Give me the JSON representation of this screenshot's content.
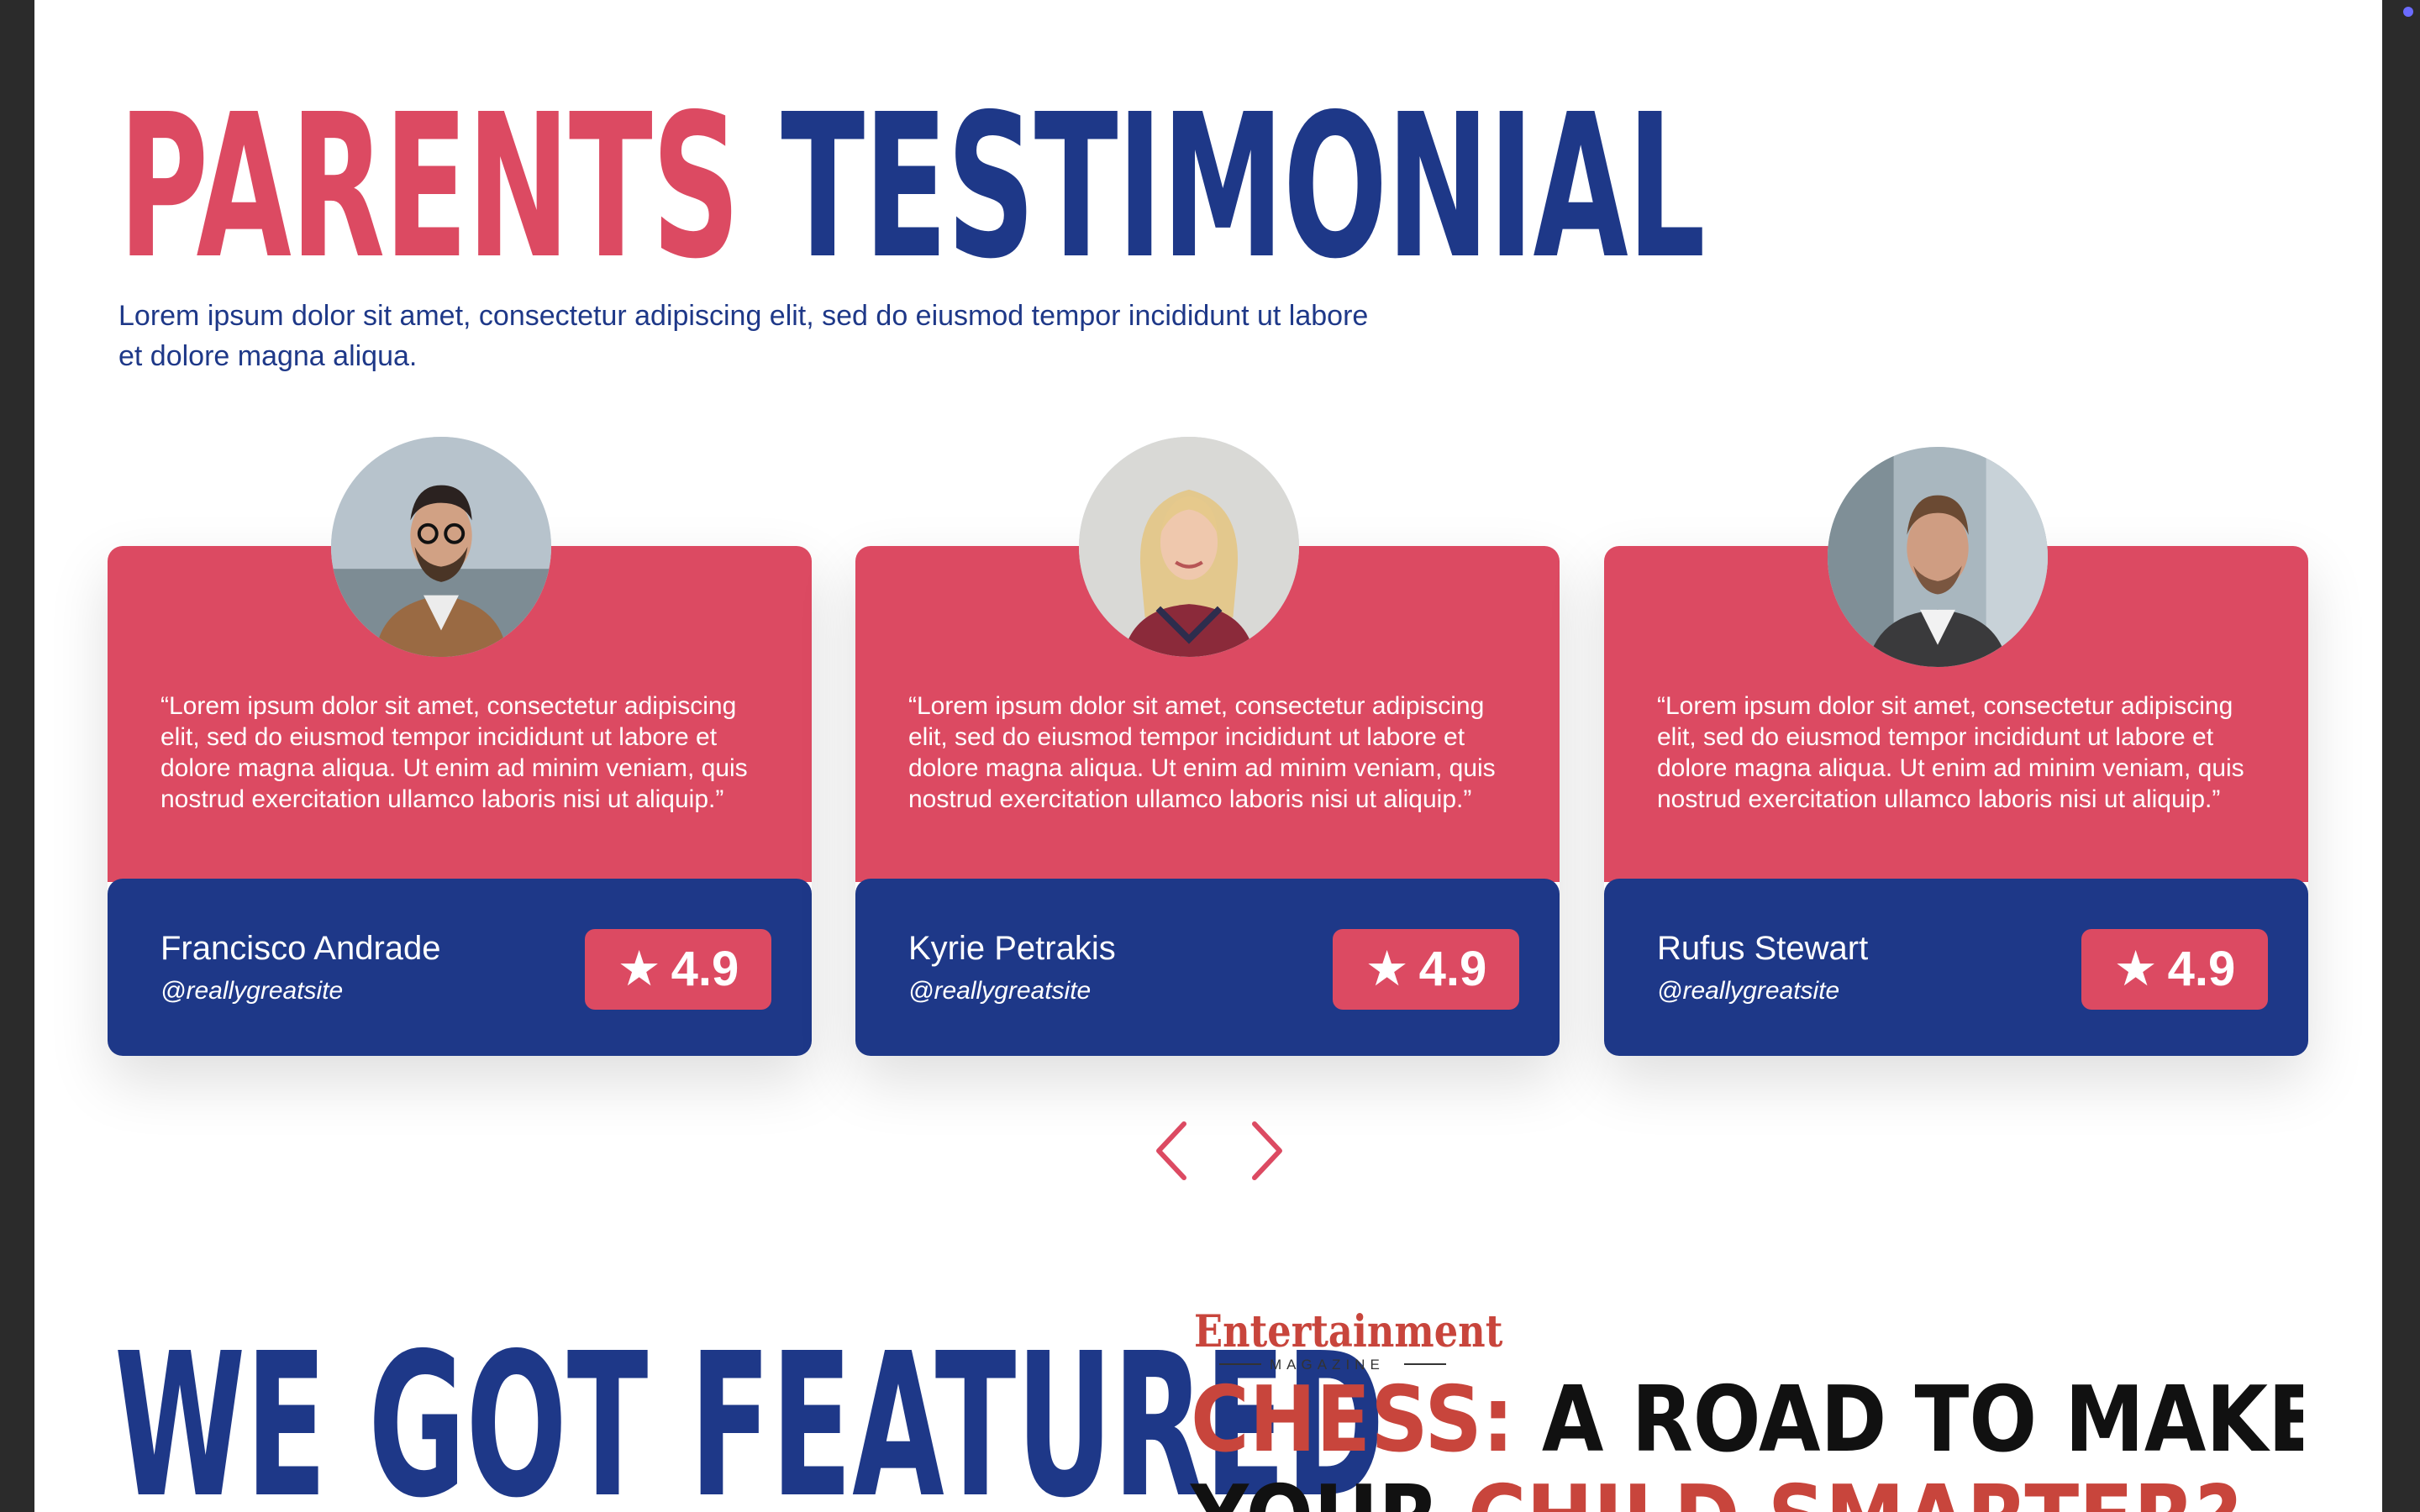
{
  "testimonials": {
    "title_part1": "PARENTS",
    "title_part2": "TESTIMONIAL",
    "intro": "Lorem ipsum dolor sit amet, consectetur adipiscing elit, sed do eiusmod tempor incididunt ut labore et dolore magna aliqua.",
    "cards": [
      {
        "quote": "“Lorem ipsum dolor sit amet, consectetur adipiscing elit, sed do eiusmod tempor incididunt ut labore et dolore magna aliqua. Ut enim ad minim veniam, quis nostrud exercitation ullamco laboris nisi ut aliquip.”",
        "name": "Francisco Andrade",
        "handle": "@reallygreatsite",
        "rating_icon": "★",
        "rating": "4.9"
      },
      {
        "quote": "“Lorem ipsum dolor sit amet, consectetur adipiscing elit, sed do eiusmod tempor incididunt ut labore et dolore magna aliqua. Ut enim ad minim veniam, quis nostrud exercitation ullamco laboris nisi ut aliquip.”",
        "name": "Kyrie Petrakis",
        "handle": "@reallygreatsite",
        "rating_icon": "★",
        "rating": "4.9"
      },
      {
        "quote": "“Lorem ipsum dolor sit amet, consectetur adipiscing elit, sed do eiusmod tempor incididunt ut labore et dolore magna aliqua. Ut enim ad minim veniam, quis nostrud exercitation ullamco laboris nisi ut aliquip.”",
        "name": "Rufus Stewart",
        "handle": "@reallygreatsite",
        "rating_icon": "★",
        "rating": "4.9"
      }
    ]
  },
  "featured": {
    "title": "WE GOT FEATURED",
    "magazine_logo": "Entertainment",
    "magazine_sub": "MAGAZINE",
    "headline_red_1": "CHESS:",
    "headline_black_1": " A ROAD TO MAKE",
    "headline_black_2": "YOUR ",
    "headline_red_2": "CHILD SMARTER?"
  },
  "colors": {
    "brand_red": "#dc4a62",
    "brand_blue": "#1e3888",
    "background": "#ffffff"
  },
  "icons": {
    "prev": "chevron-left-icon",
    "next": "chevron-right-icon",
    "rating": "star-icon"
  }
}
